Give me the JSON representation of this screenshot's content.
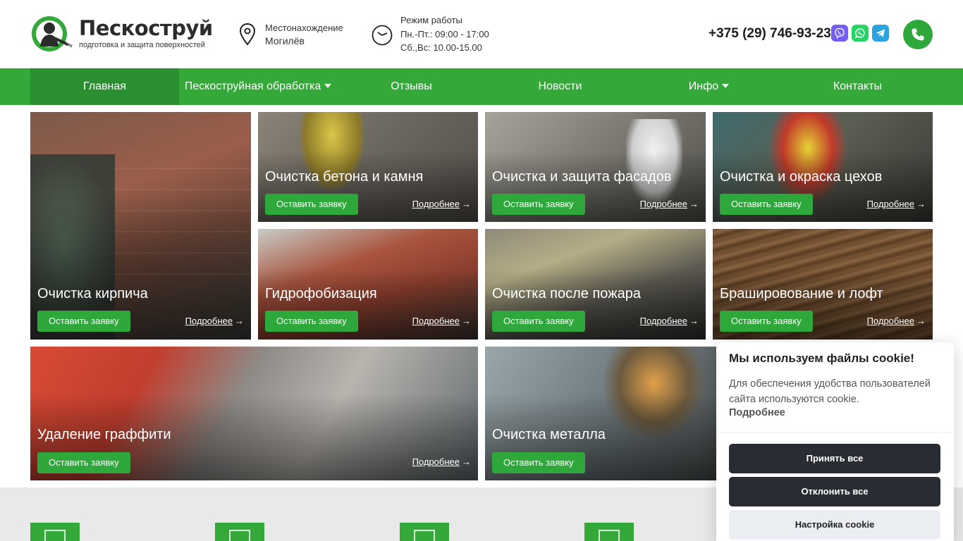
{
  "header": {
    "logo_title": "Пескоструй",
    "logo_subtitle": "подготовка и защита поверхностей",
    "location_label": "Местонахождение",
    "location_value": "Могилёв",
    "hours_label": "Режим работы",
    "hours_weekdays": "Пн.-Пт.: 09:00 - 17:00",
    "hours_weekend": "Сб.,Вс: 10.00-15.00",
    "phone": "+375 (29) 746-93-23",
    "messengers": [
      "viber-icon",
      "whatsapp-icon",
      "telegram-icon"
    ]
  },
  "nav": {
    "items": [
      {
        "label": "Главная",
        "active": true
      },
      {
        "label": "Пескоструйная обработка",
        "dropdown": true
      },
      {
        "label": "Отзывы"
      },
      {
        "label": "Новости"
      },
      {
        "label": "Инфо",
        "dropdown": true
      },
      {
        "label": "Контакты"
      }
    ]
  },
  "cards": {
    "order_label": "Оставить заявку",
    "more_label": "Подробнее",
    "items": [
      {
        "title": "Очистка кирпича"
      },
      {
        "title": "Очистка бетона и камня"
      },
      {
        "title": "Очистка и защита фасадов"
      },
      {
        "title": "Очистка и окраска цехов"
      },
      {
        "title": "Гидрофобизация"
      },
      {
        "title": "Очистка после пожара"
      },
      {
        "title": "Брашировование и лофт"
      },
      {
        "title": "Удаление граффити"
      },
      {
        "title": "Очистка металла"
      }
    ]
  },
  "cookie": {
    "title": "Мы используем файлы cookie!",
    "text": "Для обеспечения удобства пользователей сайта используются cookie.",
    "more": "Подробнее",
    "accept": "Принять все",
    "reject": "Отклонить все",
    "settings": "Настройка cookie"
  },
  "colors": {
    "brand_green": "#35a83a",
    "nav_active": "#2a8f31",
    "button_green": "#2ea83a",
    "cookie_dark": "#2a2c33"
  }
}
